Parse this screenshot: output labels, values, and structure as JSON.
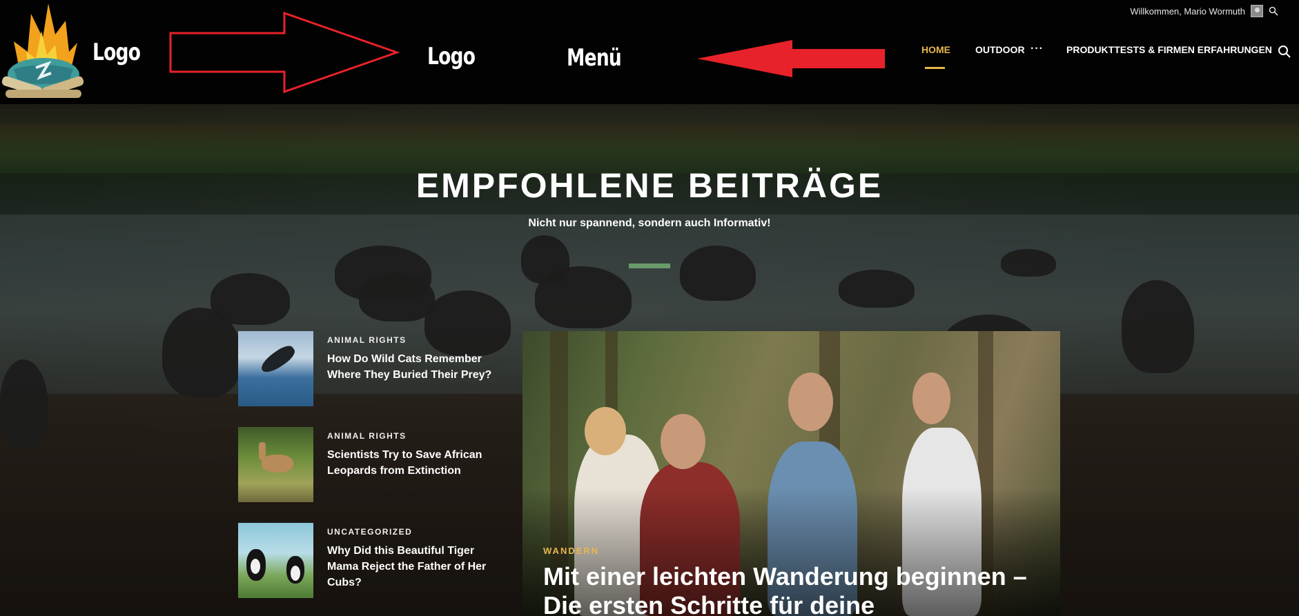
{
  "header": {
    "welcome_text": "Willkommen, Mario Wormuth",
    "logo_text_1": "Logo",
    "logo_text_2": "Logo",
    "menu_label": "Menü",
    "nav": {
      "home": "HOME",
      "outdoor": "OUTDOOR",
      "more": "···",
      "produkttests": "PRODUKTTESTS & FIRMEN ERFAHRUNGEN"
    },
    "icons": [
      "campfire-logo-icon",
      "avatar-icon",
      "search-icon"
    ]
  },
  "hero": {
    "title": "EMPFOHLENE BEITRÄGE",
    "subtitle": "Nicht nur spannend, sondern auch Informativ!"
  },
  "posts": [
    {
      "category": "ANIMAL RIGHTS",
      "title": "How Do Wild Cats Remember Where They Buried Their Prey?",
      "thumb": "whale"
    },
    {
      "category": "ANIMAL RIGHTS",
      "title": "Scientists Try to Save African Leopards from Extinction",
      "thumb": "deer"
    },
    {
      "category": "UNCATEGORIZED",
      "title": "Why Did this Beautiful Tiger Mama Reject the Father of Her Cubs?",
      "thumb": "puffins"
    }
  ],
  "featured": {
    "category": "WANDERN",
    "title": "Mit einer leichten Wanderung beginnen – Die ersten Schritte für deine"
  },
  "colors": {
    "accent": "#e7b74d",
    "annotation_red": "#e8222a",
    "header_bg": "#020202",
    "hero_bar": "#6a9a6c"
  }
}
